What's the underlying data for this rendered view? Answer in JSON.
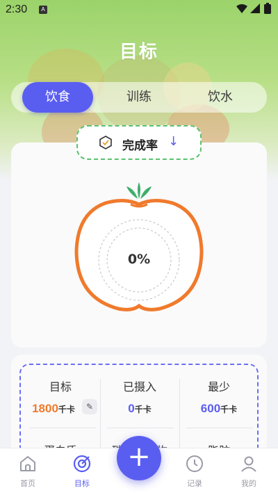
{
  "status_bar": {
    "time": "2:30",
    "notif_badge": "A"
  },
  "header": {
    "title": "目标"
  },
  "tabs": [
    {
      "label": "饮食",
      "active": true
    },
    {
      "label": "训练",
      "active": false
    },
    {
      "label": "饮水",
      "active": false
    }
  ],
  "completion": {
    "label": "完成率",
    "sort_icon": "arrow-down-icon",
    "percent": "0%"
  },
  "stats": {
    "row1": [
      {
        "label": "目标",
        "value": "1800",
        "unit": "千卡",
        "color": "#f07a2c",
        "editable": true
      },
      {
        "label": "已摄入",
        "value": "0",
        "unit": "千卡",
        "color": "#5a5ef0"
      },
      {
        "label": "最少",
        "value": "600",
        "unit": "千卡",
        "color": "#5a5ef0"
      }
    ],
    "row2_labels": [
      "蛋白质",
      "碳水化合物",
      "脂肪"
    ]
  },
  "nav": {
    "items": [
      {
        "label": "首页",
        "icon": "home-icon",
        "active": false
      },
      {
        "label": "目标",
        "icon": "target-icon",
        "active": true
      },
      {
        "label": "记录",
        "icon": "clock-icon",
        "active": false
      },
      {
        "label": "我的",
        "icon": "user-icon",
        "active": false
      }
    ],
    "fab_label": "+"
  },
  "colors": {
    "accent": "#5a5ef0",
    "tomato": "#f07a2c",
    "leaf": "#3fae6a",
    "dash_green": "#5ac26e"
  }
}
